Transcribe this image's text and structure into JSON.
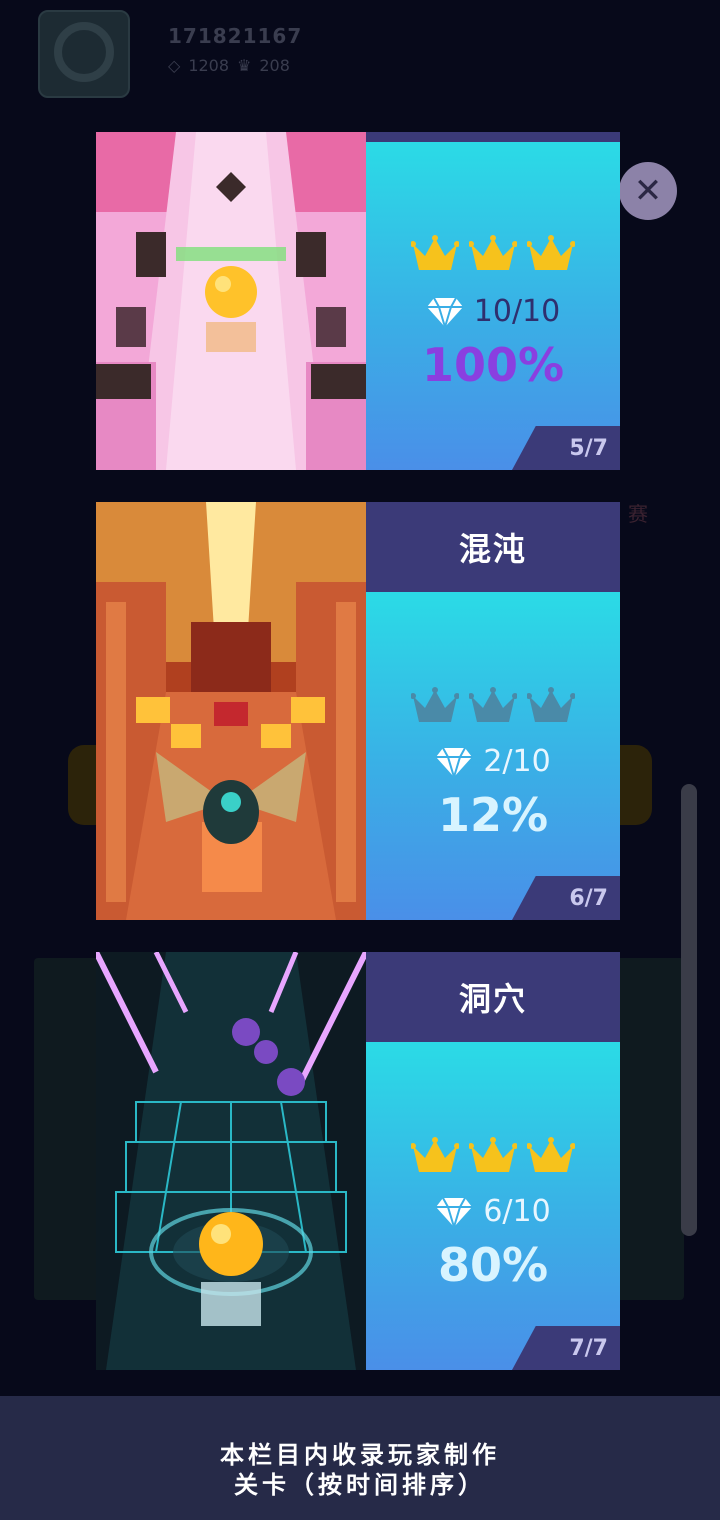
{
  "profile": {
    "player_id": "171821167",
    "gems": "1208",
    "crowns": "208"
  },
  "background_hint": "赛",
  "close": {
    "icon": "close-icon"
  },
  "levels": [
    {
      "name": "",
      "gems": "10/10",
      "percent": "100%",
      "page": "5/7",
      "crowns_earned": 3,
      "percent_color": "#8a3fe0",
      "gem_text_color": "#2f2f6e",
      "theme": "pink"
    },
    {
      "name": "混沌",
      "gems": "2/10",
      "percent": "12%",
      "page": "6/7",
      "crowns_earned": 0,
      "percent_color": "#d8f4ff",
      "gem_text_color": "#e8f6ff",
      "theme": "egypt"
    },
    {
      "name": "洞穴",
      "gems": "6/10",
      "percent": "80%",
      "page": "7/7",
      "crowns_earned": 3,
      "percent_color": "#d8f4ff",
      "gem_text_color": "#e8f6ff",
      "theme": "cyber"
    }
  ],
  "footer": {
    "line1": "本栏目内收录玩家制作",
    "line2": "关卡（按时间排序）"
  },
  "colors": {
    "crown_gold": "#f6c21c",
    "crown_empty": "#4a8aa8",
    "title_bar": "#3b3a78"
  }
}
